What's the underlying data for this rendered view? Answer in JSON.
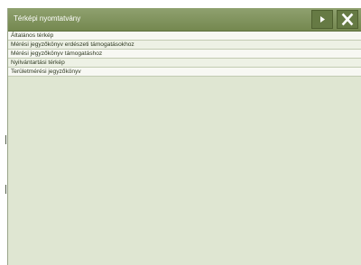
{
  "panel": {
    "title": "Térképi nyomtatvány",
    "buttons": {
      "next_icon": "play-arrow-icon",
      "close_icon": "close-x-icon"
    }
  },
  "list": {
    "items": [
      {
        "label": "Általános térkép"
      },
      {
        "label": "Mérési jegyzőkönyv erdészeti támogatásokhoz"
      },
      {
        "label": "Mérési jegyzőkönyv támogatáshoz"
      },
      {
        "label": "Nyilvántartási térkép"
      },
      {
        "label": "Területmérési jegyzőkönyv"
      }
    ]
  },
  "colors": {
    "titlebar": "#7f9360",
    "panel_bg": "#dfe6d2",
    "button_bg": "#667a44"
  }
}
